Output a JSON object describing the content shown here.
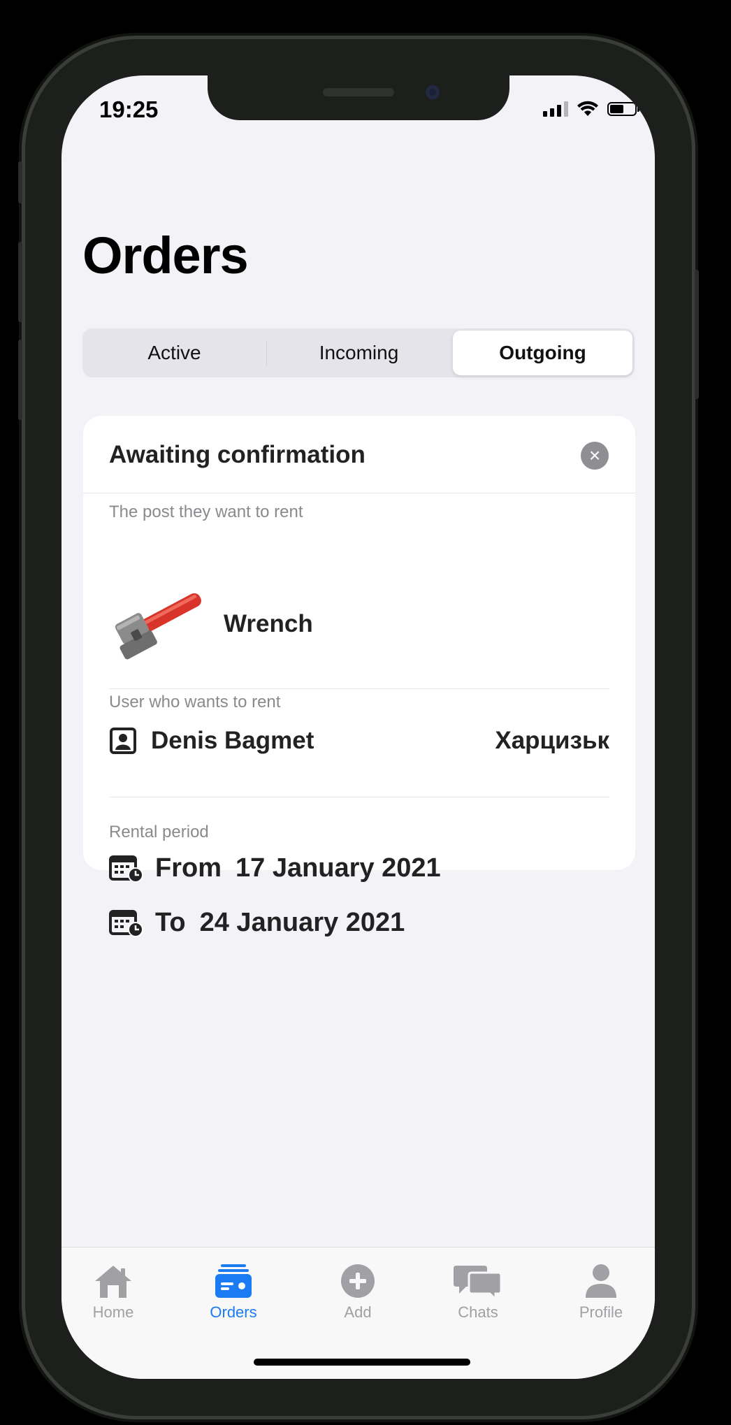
{
  "status_bar": {
    "time": "19:25"
  },
  "header": {
    "title": "Orders"
  },
  "segments": [
    {
      "label": "Active",
      "selected": false
    },
    {
      "label": "Incoming",
      "selected": false
    },
    {
      "label": "Outgoing",
      "selected": true
    }
  ],
  "order_card": {
    "status_title": "Awaiting confirmation",
    "post_section_label": "The post they want to rent",
    "post_name": "Wrench",
    "user_section_label": "User who wants to rent",
    "user_name": "Denis Bagmet",
    "user_city": "Харцизьк",
    "period_section_label": "Rental period",
    "from_label": "From",
    "from_date": "17 January 2021",
    "to_label": "To",
    "to_date": "24 January 2021"
  },
  "tab_bar": {
    "items": [
      {
        "label": "Home",
        "icon": "house-icon"
      },
      {
        "label": "Orders",
        "icon": "orders-icon",
        "active": true
      },
      {
        "label": "Add",
        "icon": "plus-circle-icon"
      },
      {
        "label": "Chats",
        "icon": "chat-bubbles-icon"
      },
      {
        "label": "Profile",
        "icon": "person-icon"
      }
    ]
  },
  "colors": {
    "accent": "#1b7bf2",
    "inactive_tab": "#a0a0a5",
    "background": "#f2f2f7",
    "wrench_red": "#d8342a"
  }
}
